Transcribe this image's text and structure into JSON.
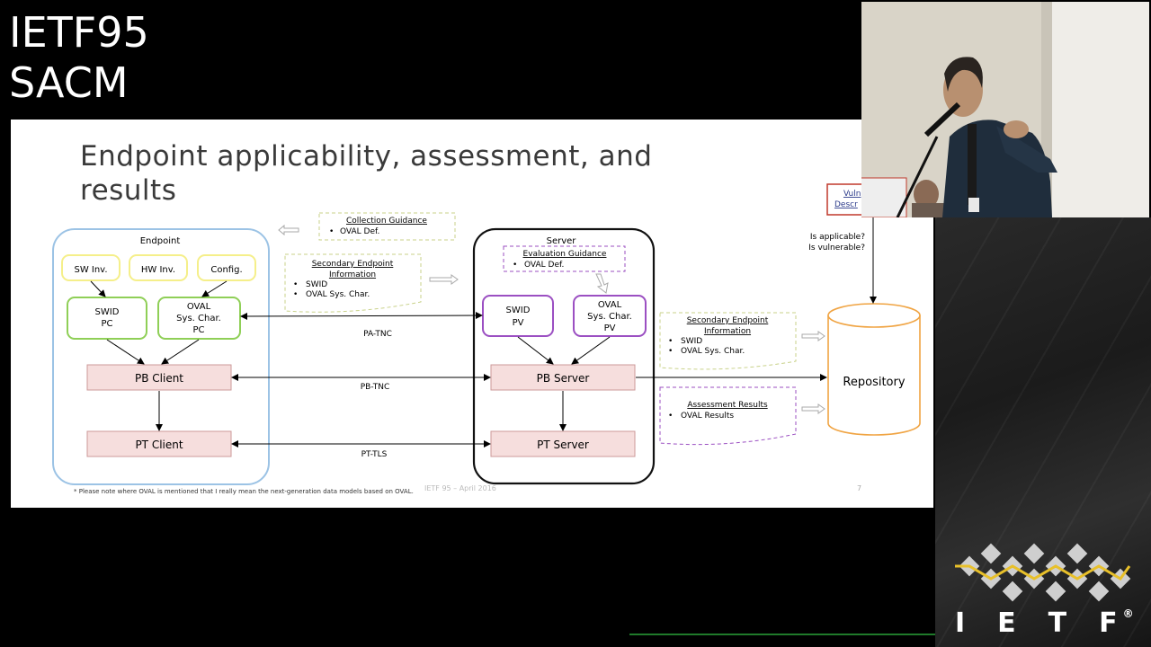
{
  "overlay": {
    "line1": "IETF95",
    "line2": "SACM"
  },
  "slide": {
    "title_line1": "Endpoint applicability, assessment, and",
    "title_line2": "results",
    "footnote": "* Please note where OVAL is mentioned that I really mean the next-generation data models based on OVAL.",
    "footer_center": "IETF 95 – April 2016",
    "page_number": "7"
  },
  "diagram": {
    "endpoint": {
      "label": "Endpoint",
      "inv_sw": "SW Inv.",
      "inv_hw": "HW Inv.",
      "inv_config": "Config.",
      "swid_pc": [
        "SWID",
        "PC"
      ],
      "oval_pc": [
        "OVAL",
        "Sys. Char.",
        "PC"
      ],
      "pb_client": "PB Client",
      "pt_client": "PT Client"
    },
    "server": {
      "label": "Server",
      "eval_guidance_title": "Evaluation Guidance",
      "eval_guidance_item": "OVAL Def.",
      "swid_pv": [
        "SWID",
        "PV"
      ],
      "oval_pv": [
        "OVAL",
        "Sys. Char.",
        "PV"
      ],
      "pb_server": "PB Server",
      "pt_server": "PT Server"
    },
    "collection_guidance": {
      "title": "Collection Guidance",
      "item": "OVAL Def."
    },
    "secondary_left": {
      "title1": "Secondary Endpoint",
      "title2": "Information",
      "items": [
        "SWID",
        "OVAL Sys. Char."
      ]
    },
    "secondary_right": {
      "title1": "Secondary Endpoint",
      "title2": "Information",
      "items": [
        "SWID",
        "OVAL Sys. Char."
      ]
    },
    "assessment_results": {
      "title": "Assessment Results",
      "item": "OVAL Results"
    },
    "protocols": {
      "pa": "PA-TNC",
      "pb": "PB-TNC",
      "pt": "PT-TLS"
    },
    "repository": "Repository",
    "questions": [
      "Is applicable?",
      "Is vulnerable?"
    ],
    "vuln_box": [
      "Vuln",
      "Descr"
    ]
  },
  "logo": {
    "text": "IETF",
    "registered": "®"
  },
  "colors": {
    "endpoint_border": "#9cc3e5",
    "inventory_border": "#f5ef8a",
    "collector_border": "#8fcf57",
    "server_border": "#111111",
    "validator_border": "#9b4fc2",
    "pb_fill": "#f6dedd",
    "pb_border": "#c99",
    "repository_border": "#f0a443",
    "logo_yellow": "#e8c02a"
  }
}
